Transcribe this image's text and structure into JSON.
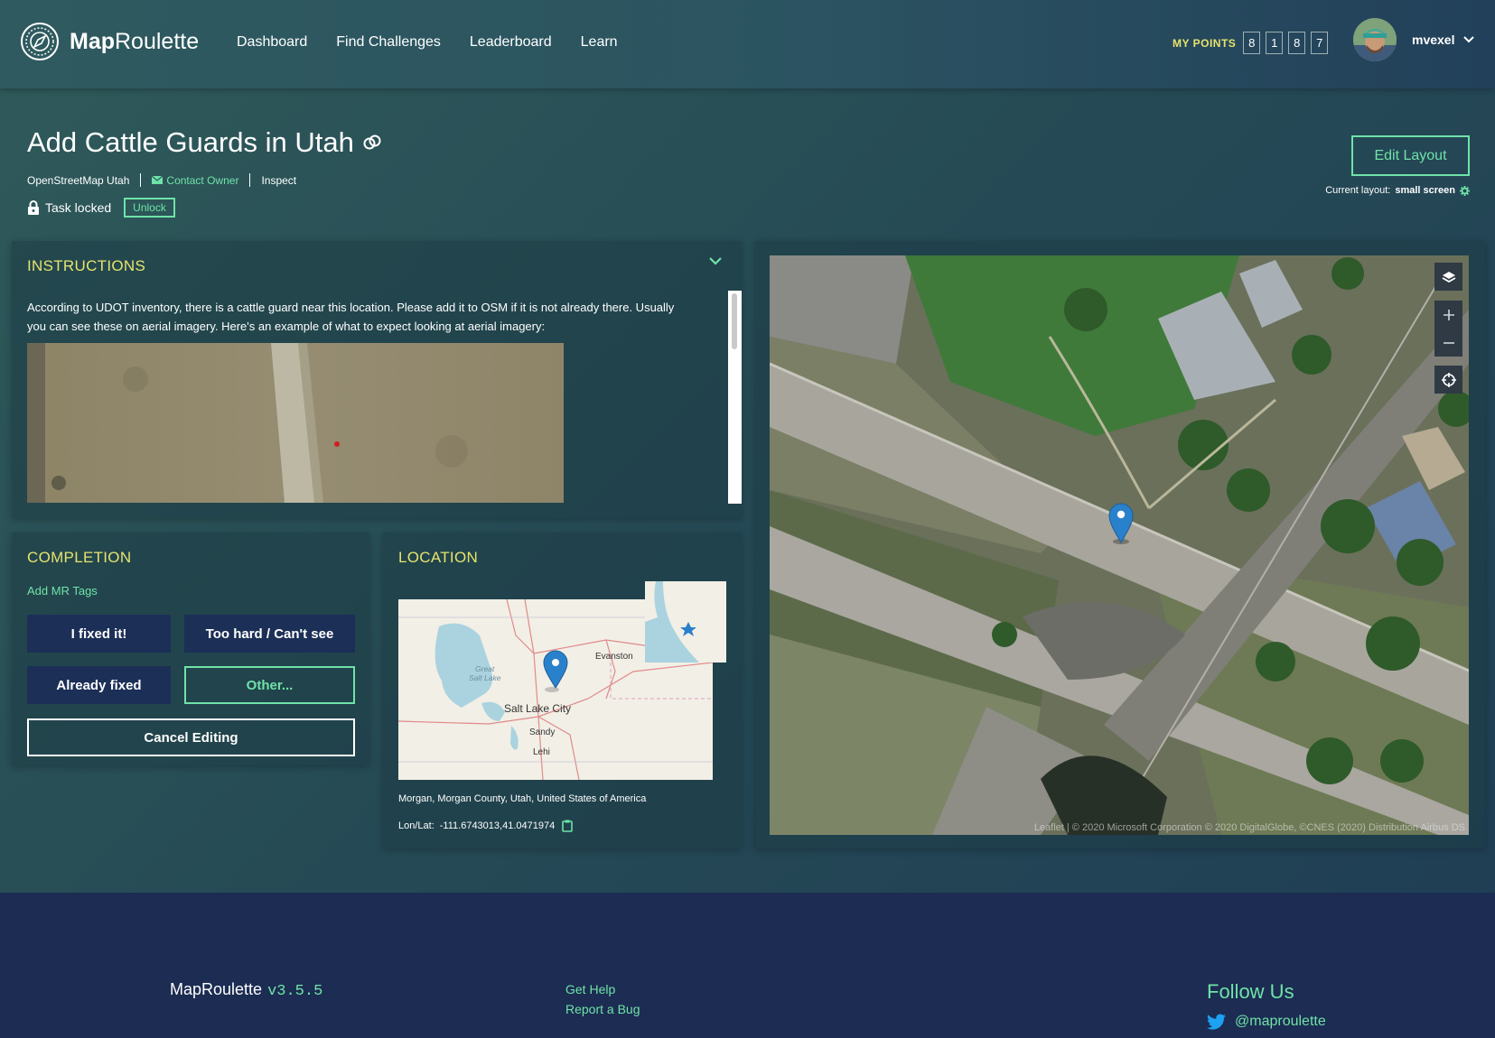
{
  "app": {
    "logo_bold": "Map",
    "logo_rest": "Roulette"
  },
  "nav": {
    "items": [
      "Dashboard",
      "Find Challenges",
      "Leaderboard",
      "Learn"
    ]
  },
  "points": {
    "label": "MY POINTS",
    "digits": [
      "8",
      "1",
      "8",
      "7"
    ]
  },
  "user": {
    "name": "mvexel"
  },
  "task": {
    "title": "Add Cattle Guards in Utah",
    "owner_org": "OpenStreetMap Utah",
    "contact_owner": "Contact Owner",
    "inspect": "Inspect",
    "lock_status": "Task locked",
    "unlock_label": "Unlock"
  },
  "layout": {
    "edit_button": "Edit Layout",
    "current_label": "Current layout:",
    "current_value": "small screen"
  },
  "instructions": {
    "title": "INSTRUCTIONS",
    "text": "According to UDOT inventory, there is a cattle guard near this location. Please add it to OSM if it is not already there. Usually you can see these on aerial imagery. Here's an example of what to expect looking at aerial imagery:"
  },
  "completion": {
    "title": "COMPLETION",
    "add_tags": "Add MR Tags",
    "fixed": "I fixed it!",
    "too_hard": "Too hard / Can't see",
    "already_fixed": "Already fixed",
    "other": "Other...",
    "cancel": "Cancel Editing"
  },
  "location": {
    "title": "LOCATION",
    "map_labels": {
      "evanston": "Evanston",
      "great_salt_lake_1": "Great",
      "great_salt_lake_2": "Salt Lake",
      "slc": "Salt Lake City",
      "sandy": "Sandy",
      "lehi": "Lehi"
    },
    "address": "Morgan, Morgan County, Utah, United States of America",
    "coords_label": "Lon/Lat:",
    "coords_value": "-111.6743013,41.0471974"
  },
  "map": {
    "attribution": "Leaflet | © 2020 Microsoft Corporation © 2020 DigitalGlobe, ©CNES (2020) Distribution Airbus DS"
  },
  "footer": {
    "brand": "MapRoulette",
    "version": "v3.5.5",
    "get_help": "Get Help",
    "report_bug": "Report a Bug",
    "follow_title": "Follow Us",
    "twitter_handle": "@maproulette"
  },
  "colors": {
    "accent_green": "#6fe3a8",
    "accent_yellow": "#e6e36d",
    "dark_button": "#1c2f56",
    "footer_bg": "#1c2c52"
  }
}
